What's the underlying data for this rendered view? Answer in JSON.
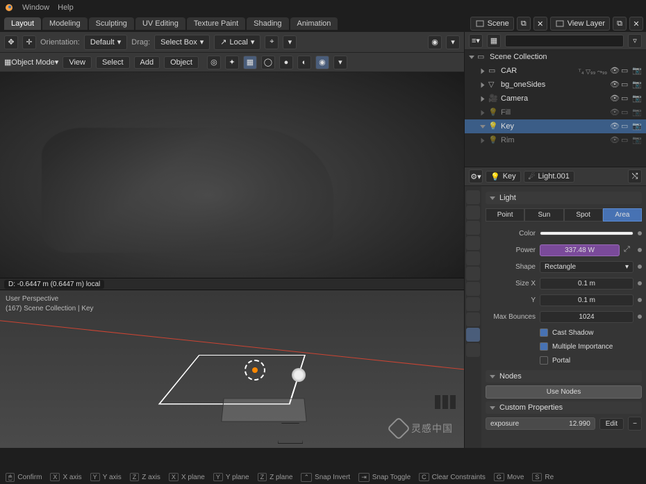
{
  "menu": {
    "window": "Window",
    "help": "Help"
  },
  "workspaces": [
    "Layout",
    "Modeling",
    "Sculpting",
    "UV Editing",
    "Texture Paint",
    "Shading",
    "Animation"
  ],
  "workspace_active": "Layout",
  "scene": {
    "label": "Scene",
    "layer_label": "View Layer"
  },
  "toolrow": {
    "orientation_label": "Orientation:",
    "orientation_value": "Default",
    "drag_label": "Drag:",
    "drag_value": "Select Box",
    "transform_value": "Local"
  },
  "toolrow2": {
    "mode": "Object Mode",
    "view": "View",
    "select": "Select",
    "add": "Add",
    "object": "Object"
  },
  "transform_status": "D: -0.6447 m (0.6447 m) local",
  "hud": {
    "persp": "User Perspective",
    "coll": "(167) Scene Collection | Key"
  },
  "outliner": {
    "root": "Scene Collection",
    "items": [
      {
        "name": "CAR",
        "indent": 1,
        "type": "collection",
        "expanded": false,
        "suffix": "⸆₄ ▽₉₉ ⤳₉₉"
      },
      {
        "name": "bg_oneSides",
        "indent": 1,
        "type": "mesh",
        "expanded": false,
        "suffix": ""
      },
      {
        "name": "Camera",
        "indent": 1,
        "type": "camera",
        "expanded": false,
        "suffix": ""
      },
      {
        "name": "Fill",
        "indent": 1,
        "type": "light-off",
        "expanded": false,
        "suffix": ""
      },
      {
        "name": "Key",
        "indent": 1,
        "type": "light",
        "expanded": true,
        "selected": true,
        "suffix": ""
      },
      {
        "name": "Rim",
        "indent": 1,
        "type": "light-off",
        "expanded": false,
        "suffix": ""
      }
    ]
  },
  "props": {
    "object_name": "Key",
    "data_name": "Light.001",
    "panel_light": "Light",
    "types": [
      "Point",
      "Sun",
      "Spot",
      "Area"
    ],
    "type_active": "Area",
    "color_label": "Color",
    "power_label": "Power",
    "power_value": "337.48 W",
    "shape_label": "Shape",
    "shape_value": "Rectangle",
    "sizex_label": "Size X",
    "sizex_value": "0.1 m",
    "sizey_label": "Y",
    "sizey_value": "0.1 m",
    "bounces_label": "Max Bounces",
    "bounces_value": "1024",
    "cast_shadow": "Cast Shadow",
    "multi_importance": "Multiple Importance",
    "portal": "Portal",
    "panel_nodes": "Nodes",
    "use_nodes": "Use Nodes",
    "panel_custom": "Custom Properties",
    "exposure_label": "exposure",
    "exposure_value": "12.990",
    "edit": "Edit"
  },
  "status": {
    "confirm": "Confirm",
    "xaxis": "X axis",
    "yaxis": "Y axis",
    "zaxis": "Z axis",
    "xplane": "X plane",
    "yplane": "Y plane",
    "zplane": "Z plane",
    "snap_invert": "Snap Invert",
    "snap_toggle": "Snap Toggle",
    "clear_constraints": "Clear Constraints",
    "move": "Move",
    "resize": "Re"
  },
  "watermark": "灵感中国"
}
